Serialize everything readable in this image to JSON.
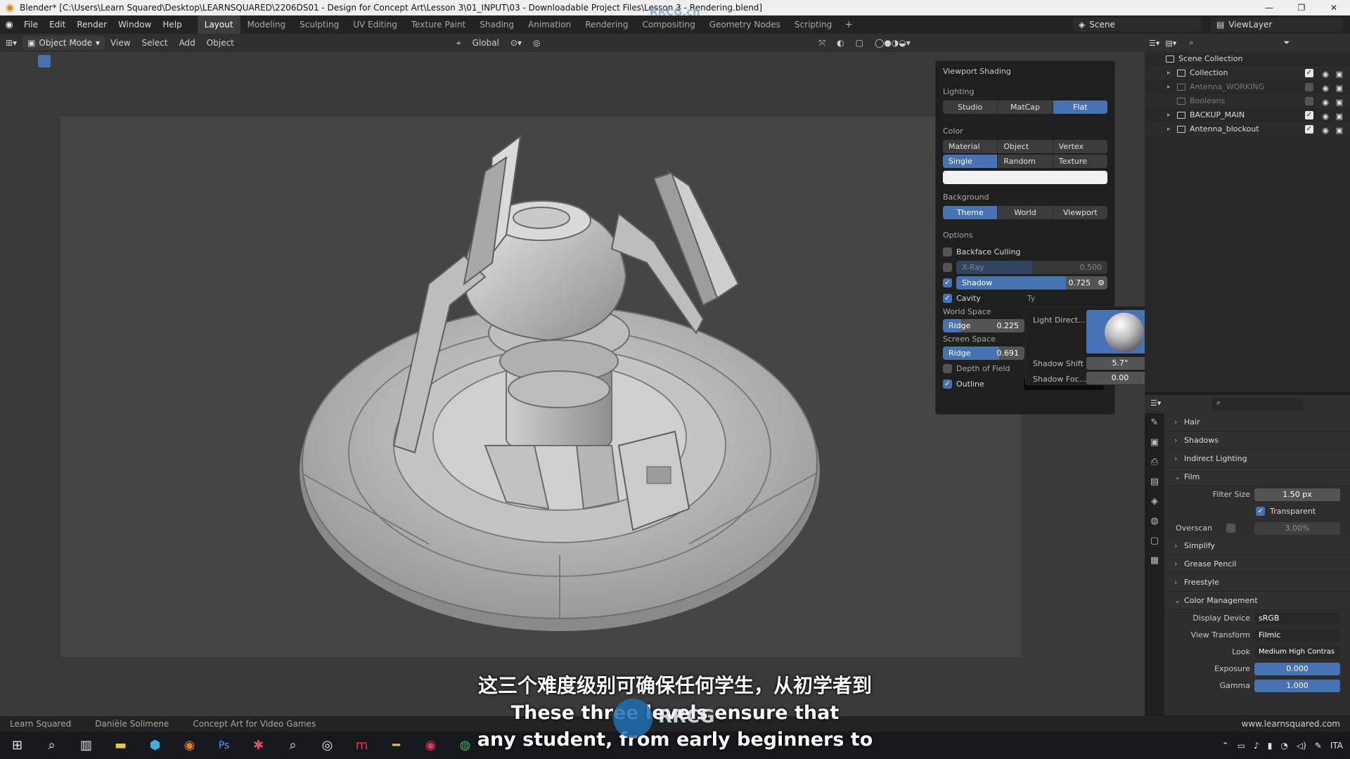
{
  "window": {
    "title": "Blender* [C:\\Users\\Learn Squared\\Desktop\\LEARNSQUARED\\2206DS01 - Design for Concept Art\\Lesson 3\\01_INPUT\\03 - Downloadable Project Files\\Lesson 3 - Rendering.blend]",
    "controls": [
      "—",
      "❐",
      "✕"
    ]
  },
  "watermark_top": "RRCG.cn",
  "menu": [
    "File",
    "Edit",
    "Render",
    "Window",
    "Help"
  ],
  "workspaces": [
    "Layout",
    "Modeling",
    "Sculpting",
    "UV Editing",
    "Texture Paint",
    "Shading",
    "Animation",
    "Rendering",
    "Compositing",
    "Geometry Nodes",
    "Scripting"
  ],
  "workspace_add": "+",
  "scene": "Scene",
  "view_layer": "ViewLayer",
  "viewport_header": {
    "mode": "Object Mode",
    "menus": [
      "View",
      "Select",
      "Add",
      "Object"
    ],
    "orientation": "Global",
    "object_menu": "Object"
  },
  "shading_popover": {
    "title": "Viewport Shading",
    "lighting_label": "Lighting",
    "lighting_options": [
      "Studio",
      "MatCap",
      "Flat"
    ],
    "lighting_selected": "Flat",
    "color_label": "Color",
    "color_options_row1": [
      "Material",
      "Object",
      "Vertex"
    ],
    "color_options_row2": [
      "Single",
      "Random",
      "Texture"
    ],
    "color_selected": "Single",
    "background_label": "Background",
    "background_options": [
      "Theme",
      "World",
      "Viewport"
    ],
    "background_selected": "Theme",
    "options_label": "Options",
    "backface_culling": "Backface Culling",
    "xray_label": "X-Ray",
    "xray_value": "0.500",
    "xray_fraction": 0.5,
    "shadow_label": "Shadow",
    "shadow_value": "0.725",
    "shadow_fraction": 0.725,
    "cavity_label": "Cavity",
    "cavity_type_short": "Ty",
    "world_space_label": "World Space",
    "ws_ridge_label": "Ridge",
    "ws_ridge_value": "0.225",
    "ws_ridge_fraction": 0.225,
    "screen_space_label": "Screen Space",
    "ss_ridge_label": "Ridge",
    "ss_ridge_value": "0.691",
    "ss_ridge_fraction": 0.691,
    "dof_label": "Depth of Field",
    "outline_label": "Outline"
  },
  "shadow_subpanel": {
    "light_direction_label": "Light Direct...",
    "shadow_shift_label": "Shadow Shift",
    "shadow_shift_value": "5.7°",
    "shadow_focus_label": "Shadow Foc...",
    "shadow_focus_value": "0.00"
  },
  "outliner": {
    "rows": [
      {
        "name": "Scene Collection",
        "dim": false
      },
      {
        "name": "Collection",
        "dim": false
      },
      {
        "name": "Antenna_WORKING",
        "dim": true
      },
      {
        "name": "Booleans",
        "dim": true
      },
      {
        "name": "BACKUP_MAIN",
        "dim": false
      },
      {
        "name": "Antenna_blockout",
        "dim": false
      }
    ]
  },
  "properties": {
    "panels_top": [
      "Hair",
      "Shadows",
      "Indirect Lighting",
      "Film"
    ],
    "filter_size_label": "Filter Size",
    "filter_size_value": "1.50 px",
    "transparent_label": "Transparent",
    "overscan_label": "Overscan",
    "overscan_value": "3.00%",
    "panels_mid": [
      "Simplify",
      "Grease Pencil",
      "Freestyle",
      "Color Management"
    ],
    "display_device_label": "Display Device",
    "display_device_value": "sRGB",
    "view_transform_label": "View Transform",
    "view_transform_value": "Filmic",
    "look_label": "Look",
    "look_value": "Medium High Contras",
    "exposure_label": "Exposure",
    "exposure_value": "0.000",
    "gamma_label": "Gamma",
    "gamma_value": "1.000"
  },
  "statusbar": {
    "items": [
      "Learn Squared",
      "Danièle Solimene",
      "Concept Art for Video Games"
    ],
    "site": "www.learnsquared.com"
  },
  "subtitles": {
    "zh": "这三个难度级别可确保任何学生，从初学者到",
    "en1": "These three levels ensure that",
    "en2": "any student, from early beginners to"
  },
  "tray": {
    "lang": "ITA"
  },
  "colors": {
    "accent": "#4772b3",
    "panel": "#303030",
    "viewport": "#3a3a3a"
  }
}
